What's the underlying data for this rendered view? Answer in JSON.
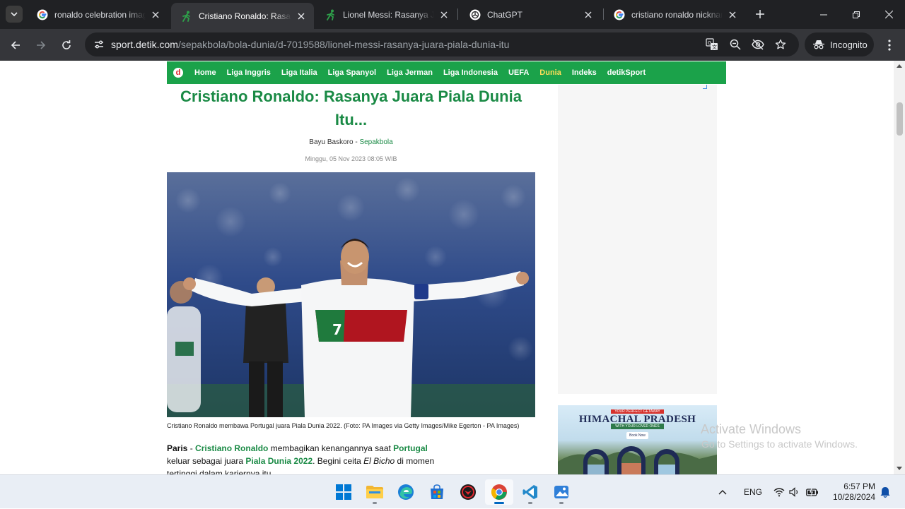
{
  "browser": {
    "tabs": [
      {
        "title": "ronaldo celebration imag",
        "favicon": "google-icon",
        "active": false
      },
      {
        "title": "Cristiano Ronaldo: Rasanya",
        "favicon": "detik-runner-icon",
        "active": true
      },
      {
        "title": "Lionel Messi: Rasanya Jua",
        "favicon": "detik-runner-icon",
        "active": false
      },
      {
        "title": "ChatGPT",
        "favicon": "chatgpt-icon",
        "active": false
      },
      {
        "title": "cristiano ronaldo nicknam",
        "favicon": "google-icon",
        "active": false
      }
    ],
    "url_host": "sport.detik.com",
    "url_path": "/sepakbola/bola-dunia/d-7019588/lionel-messi-rasanya-juara-piala-dunia-itu",
    "incognito_label": "Incognito",
    "colors": {
      "frame": "#202124",
      "toolbar": "#35363a",
      "omnibox": "#202124"
    }
  },
  "site": {
    "nav_items": [
      "Home",
      "Liga Inggris",
      "Liga Italia",
      "Liga Spanyol",
      "Liga Jerman",
      "Liga Indonesia",
      "UEFA",
      "Dunia",
      "Indeks",
      "detikSport"
    ],
    "active_nav": "Dunia",
    "logo_letter": "d",
    "colors": {
      "nav_bg": "#1ba24a",
      "accent": "#1a8a45",
      "active_nav": "#ffde59"
    }
  },
  "article": {
    "headline": "Cristiano Ronaldo: Rasanya Juara Piala Dunia Itu...",
    "author": "Bayu Baskoro",
    "separator": " - ",
    "category": "Sepakbola",
    "date": "Minggu, 05 Nov 2023 08:05 WIB",
    "photo_caption": "Cristiano Ronaldo membawa Portugal juara Piala Dunia 2022. (Foto: PA Images via Getty Images/Mike Egerton - PA Images)",
    "jersey_number": "7",
    "body": {
      "dateline": "Paris",
      "dash": " - ",
      "link_ronaldo": "Cristiano Ronaldo",
      "t1": " membagikan kenangannya saat ",
      "link_portugal": "Portugal",
      "t2": " keluar sebagai juara ",
      "link_piala": "Piala Dunia 2022",
      "t3": ". Begini ceita ",
      "nickname": "El Bicho",
      "t4": " di momen tertinggi dalam kariernya itu."
    }
  },
  "ads": {
    "banner_top": "YOUR PERFECT GETAWAY",
    "banner_title": "HIMACHAL PRADESH",
    "banner_tagline": "WITH YOUR LOVED ONES",
    "banner_cta": "Book Now"
  },
  "watermark": {
    "line1": "Activate Windows",
    "line2": "Go to Settings to activate Windows."
  },
  "taskbar": {
    "apps": [
      "start-icon",
      "file-explorer-icon",
      "edge-icon",
      "store-icon",
      "game-app-icon",
      "chrome-icon",
      "vscode-icon",
      "photos-icon"
    ],
    "active_app": "chrome-icon",
    "language": "ENG",
    "time": "6:57 PM",
    "date": "10/28/2024"
  }
}
